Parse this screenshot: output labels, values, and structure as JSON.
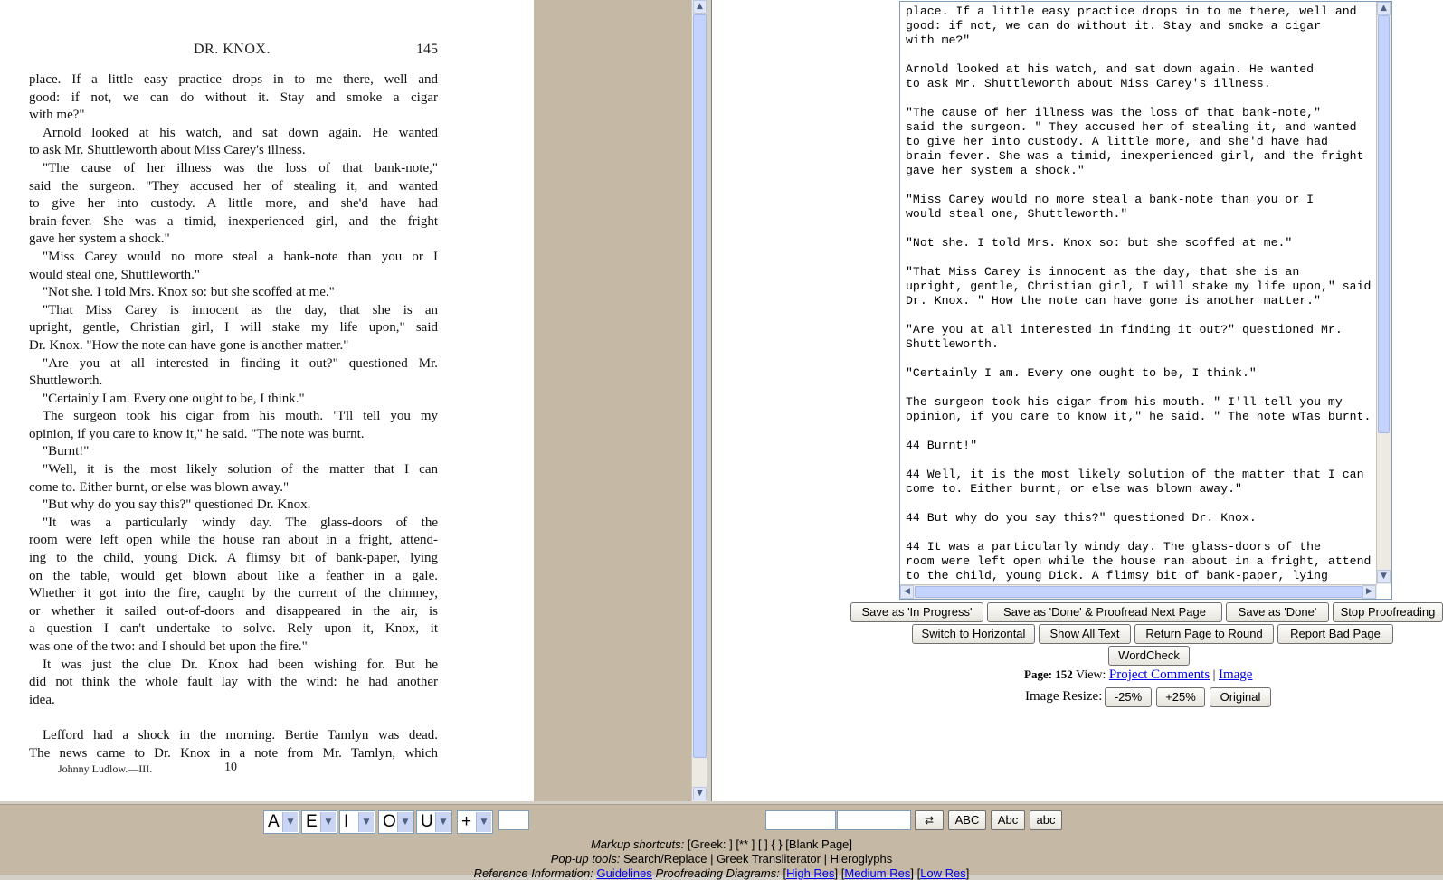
{
  "scan": {
    "header_title": "DR. KNOX.",
    "page_number": "145",
    "lines": [
      {
        "t": "place.  If a little easy practice drops in to me there, well and",
        "c": ""
      },
      {
        "t": "good: if not, we can do without it.  Stay and smoke a cigar",
        "c": ""
      },
      {
        "t": "with me?\"",
        "c": "last"
      },
      {
        "t": "Arnold looked at his watch, and sat down again.  He wanted",
        "c": "ind"
      },
      {
        "t": "to ask Mr. Shuttleworth about Miss Carey's illness.",
        "c": "last"
      },
      {
        "t": "\"The cause of her illness was the loss of that bank-note,\"",
        "c": "ind"
      },
      {
        "t": "said the surgeon.   \"They accused her of stealing it, and wanted",
        "c": ""
      },
      {
        "t": "to give her into custody.  A little more, and she'd have had",
        "c": ""
      },
      {
        "t": "brain-fever.  She was a timid, inexperienced girl, and the fright",
        "c": ""
      },
      {
        "t": "gave her system a shock.\"",
        "c": "last"
      },
      {
        "t": "\"Miss Carey would no more steal a bank-note than you or I",
        "c": "ind"
      },
      {
        "t": "would steal one, Shuttleworth.\"",
        "c": "last"
      },
      {
        "t": "\"Not she.  I told Mrs. Knox so: but she scoffed at me.\"",
        "c": "ind last"
      },
      {
        "t": "\"That Miss Carey is innocent as the day, that she is an",
        "c": "ind"
      },
      {
        "t": "upright, gentle, Christian girl, I will stake my life upon,\" said",
        "c": ""
      },
      {
        "t": "Dr. Knox.   \"How the note can have gone is another matter.\"",
        "c": "last"
      },
      {
        "t": "\"Are you at all interested in finding it out?\" questioned Mr.",
        "c": "ind"
      },
      {
        "t": "Shuttleworth.",
        "c": "last"
      },
      {
        "t": "\"Certainly I am.   Every one ought to be, I think.\"",
        "c": "ind last"
      },
      {
        "t": "The surgeon took his cigar from his mouth.   \"I'll tell you my",
        "c": "ind"
      },
      {
        "t": "opinion, if you care to know it,\" he said.   \"The note was burnt.",
        "c": "last"
      },
      {
        "t": "\"Burnt!\"",
        "c": "ind last"
      },
      {
        "t": "\"Well, it is the most likely solution of the matter that I can",
        "c": "ind"
      },
      {
        "t": "come to.   Either burnt, or else was blown away.\"",
        "c": "last"
      },
      {
        "t": "\"But why do you say this?\" questioned Dr. Knox.",
        "c": "ind last"
      },
      {
        "t": "\"It was a particularly windy day.   The glass-doors of the",
        "c": "ind"
      },
      {
        "t": "room were left open while the house ran about in a fright, attend-",
        "c": ""
      },
      {
        "t": "ing to the child, young Dick.   A flimsy bit of bank-paper, lying",
        "c": ""
      },
      {
        "t": "on the table, would get blown about like a feather in a gale.",
        "c": ""
      },
      {
        "t": "Whether it got into the fire, caught by the current of the chimney,",
        "c": ""
      },
      {
        "t": "or whether it sailed out-of-doors and disappeared in the air, is",
        "c": ""
      },
      {
        "t": "a question I can't undertake to solve.   Rely upon it, Knox, it",
        "c": ""
      },
      {
        "t": "was one of the two: and I should bet upon the fire.\"",
        "c": "last"
      },
      {
        "t": "It was just the clue Dr. Knox had been wishing for.   But he",
        "c": "ind"
      },
      {
        "t": "did not think the whole fault lay with the wind: he had another",
        "c": ""
      },
      {
        "t": "idea.",
        "c": "last"
      },
      {
        "t": "",
        "c": "blank"
      },
      {
        "t": "Lefford had a shock in the morning.   Bertie Tamlyn was dead.",
        "c": "ind"
      },
      {
        "t": "The news came to Dr. Knox in a note from Mr. Tamlyn, which",
        "c": ""
      }
    ],
    "footer_left": "Johnny Ludlow.—III.",
    "footer_sig": "10"
  },
  "editor": {
    "text": "place. If a little easy practice drops in to me there, well and\ngood: if not, we can do without it. Stay and smoke a cigar\nwith me?\"\n\nArnold looked at his watch, and sat down again. He wanted\nto ask Mr. Shuttleworth about Miss Carey's illness.\n\n\"The cause of her illness was the loss of that bank-note,\"\nsaid the surgeon. \" They accused her of stealing it, and wanted\nto give her into custody. A little more, and she'd have had\nbrain-fever. She was a timid, inexperienced girl, and the fright\ngave her system a shock.\"\n\n\"Miss Carey would no more steal a bank-note than you or I\nwould steal one, Shuttleworth.\"\n\n\"Not she. I told Mrs. Knox so: but she scoffed at me.\"\n\n\"That Miss Carey is innocent as the day, that she is an\nupright, gentle, Christian girl, I will stake my life upon,\" said\nDr. Knox. \" How the note can have gone is another matter.\"\n\n\"Are you at all interested in finding it out?\" questioned Mr.\nShuttleworth.\n\n\"Certainly I am. Every one ought to be, I think.\"\n\nThe surgeon took his cigar from his mouth. \" I'll tell you my\nopinion, if you care to know it,\" he said. \" The note wTas burnt.\n\n44 Burnt!\"\n\n44 Well, it is the most likely solution of the matter that I can\ncome to. Either burnt, or else was blown away.\"\n\n44 But why do you say this?\" questioned Dr. Knox.\n\n44 It was a particularly windy day. The glass-doors of the\nroom were left open while the house ran about in a fright, attend\nto the child, young Dick. A flimsy bit of bank-paper, lying"
  },
  "buttons": {
    "save_in_progress": "Save as 'In Progress'",
    "save_done_next": "Save as 'Done' & Proofread Next Page",
    "save_done": "Save as 'Done'",
    "stop": "Stop Proofreading",
    "switch_horizontal": "Switch to Horizontal",
    "show_all_text": "Show All Text",
    "return_page": "Return Page to Round",
    "report_bad": "Report Bad Page",
    "wordcheck": "WordCheck",
    "resize_minus": "-25%",
    "resize_plus": "+25%",
    "resize_original": "Original"
  },
  "page_info": {
    "page_label": "Page: 152",
    "view_label": "View:",
    "project_comments": "Project Comments",
    "separator": "|",
    "image_link": "Image",
    "image_resize_label": "Image Resize:"
  },
  "toolbar": {
    "selects": [
      "A",
      "E",
      "I",
      "O",
      "U",
      "+"
    ],
    "case_buttons": [
      "ABC",
      "Abc",
      "abc"
    ],
    "swap_icon": "swap-arrows-icon",
    "markup_label": "Markup shortcuts:",
    "markup_items": "[Greek: ]   [** ]   [ ]   { }   [Blank Page]",
    "popup_label": "Pop-up tools:",
    "popup_search": "Search/Replace",
    "popup_sep": "|",
    "popup_greek": "Greek Transliterator",
    "popup_hieroglyphs": "Hieroglyphs",
    "ref_label": "Reference Information:",
    "ref_guidelines": "Guidelines",
    "ref_diagrams": "Proofreading Diagrams:",
    "ref_high": "High Res",
    "ref_medium": "Medium Res",
    "ref_low": "Low Res"
  }
}
